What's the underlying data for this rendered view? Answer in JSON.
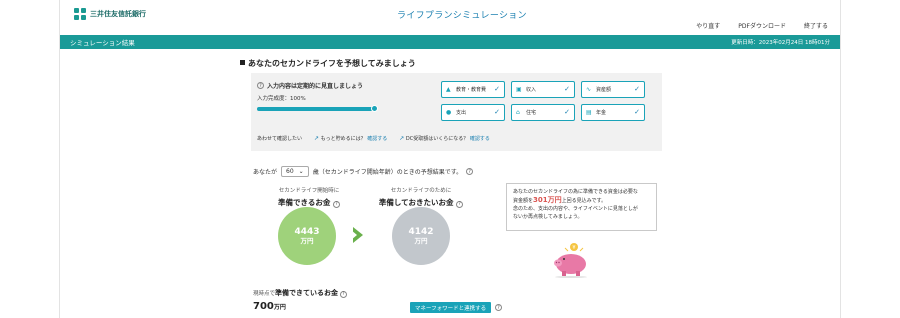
{
  "header": {
    "brand": "三井住友信託銀行",
    "app_title": "ライフプランシミュレーション",
    "links": [
      "やり直す",
      "PDFダウンロード",
      "終了する"
    ]
  },
  "bar": {
    "title": "シミュレーション結果",
    "updated": "更新日時：2023年02月24日 18時01分"
  },
  "section_title": "あなたのセカンドライフを予想してみましょう",
  "panel": {
    "check_text": "入力内容は定期的に見直しましょう",
    "completion": "入力完成度：100%",
    "progress": 1.0,
    "categories": [
      {
        "label": "教育・教育費",
        "icon": "graduation-icon"
      },
      {
        "label": "収入",
        "icon": "income-icon"
      },
      {
        "label": "資産額",
        "icon": "chart-icon"
      },
      {
        "label": "支出",
        "icon": "wallet-icon"
      },
      {
        "label": "住宅",
        "icon": "house-icon"
      },
      {
        "label": "年金",
        "icon": "document-icon"
      }
    ],
    "also_label": "あわせて確認したい",
    "also_items": [
      {
        "text": "もっと貯めるには？",
        "link": "確認する"
      },
      {
        "text": "DC受取額はいくらになる？",
        "link": "確認する"
      }
    ]
  },
  "age_line": {
    "prefix": "あなたが",
    "age": "60",
    "suffix": "歳（セカンドライフ開始年齢）のときの予想結果です。"
  },
  "prepared": {
    "small": "セカンドライフ開始時に",
    "big": "準備できるお金",
    "amount": "4443",
    "unit": "万円",
    "color": "#9fd27b"
  },
  "needed": {
    "small": "セカンドライフのために",
    "big": "準備しておきたいお金",
    "amount": "4142",
    "unit": "万円",
    "color": "#c2c7cc"
  },
  "bubble": {
    "line1": "あなたのセカンドライフの為に準備できる資金は必要な",
    "line2_pre": "資金額を",
    "line2_hl": "301万円",
    "line2_post": "上回る見込みです。",
    "line3": "念のため、支出の内容や、ライフイベントに見落としが",
    "line4": "ないか再点検してみましょう。"
  },
  "current": {
    "label_pre": "現時点で",
    "label_bold": "準備できているお金",
    "amount": "700",
    "unit": "万円",
    "button": "マネーフォワードと連携する"
  }
}
